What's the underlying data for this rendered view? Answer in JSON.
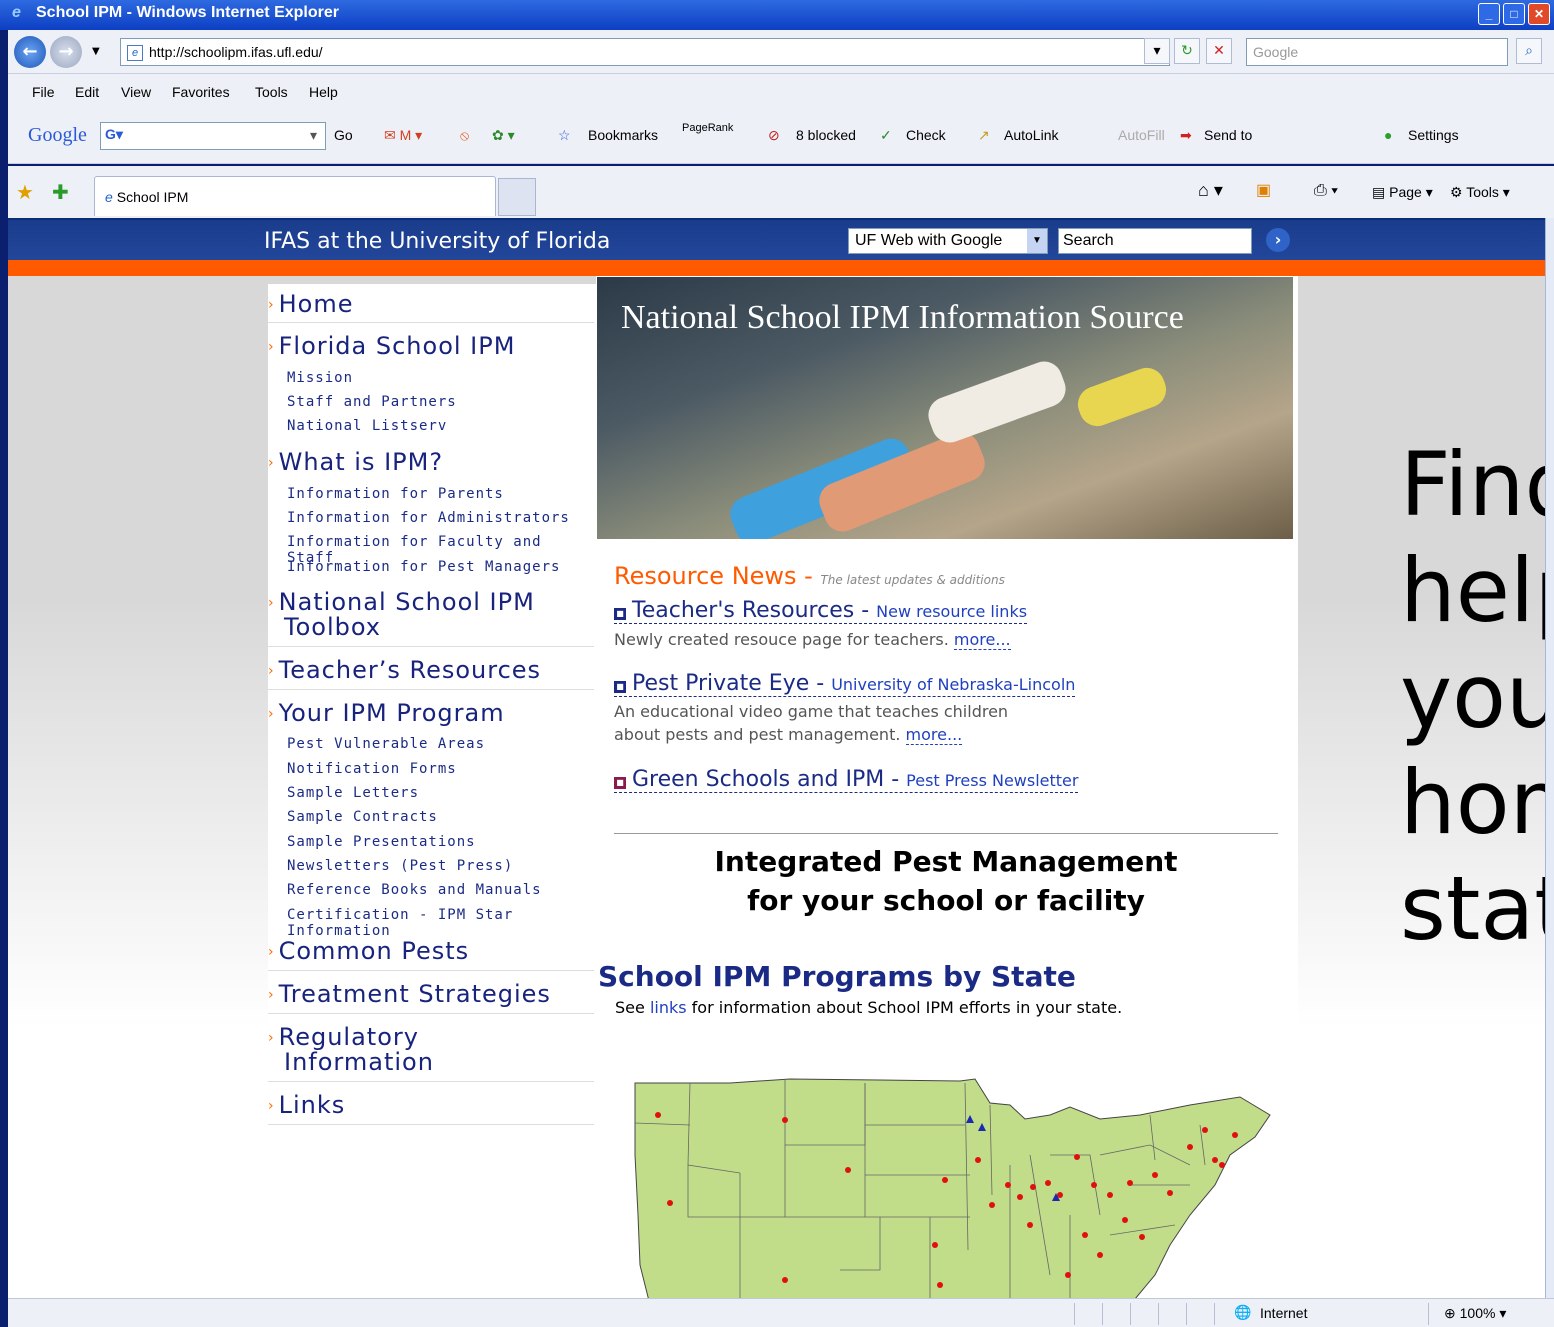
{
  "window": {
    "title": "School IPM - Windows Internet Explorer"
  },
  "address": {
    "url": "http://schoolipm.ifas.ufl.edu/",
    "search_placeholder": "Google"
  },
  "menu": [
    "File",
    "Edit",
    "View",
    "Favorites",
    "Tools",
    "Help"
  ],
  "toolbar": {
    "google_logo": "Google",
    "go": "Go",
    "bookmarks": "Bookmarks",
    "pagerank": "PageRank",
    "blocked": "8 blocked",
    "check": "Check",
    "autolink": "AutoLink",
    "autofill": "AutoFill",
    "sendto": "Send to",
    "settings": "Settings"
  },
  "tabs": {
    "active": "School IPM",
    "page_btn": "Page",
    "tools_btn": "Tools"
  },
  "ufheader": {
    "title": "IFAS at the University of Florida",
    "select": "UF Web with Google",
    "search": "Search"
  },
  "nav": {
    "home": "Home",
    "florida": "Florida School IPM",
    "florida_sub": [
      "Mission",
      "Staff and Partners",
      "National Listserv"
    ],
    "what": "What is IPM?",
    "what_sub": [
      "Information for Parents",
      "Information for Administrators",
      "Information for Faculty and Staff",
      "Information for Pest Managers"
    ],
    "toolbox_1": "National School IPM",
    "toolbox_2": "Toolbox",
    "teachers": "Teacher’s Resources",
    "program": "Your IPM Program",
    "program_sub": [
      "Pest Vulnerable Areas",
      "Notification Forms",
      "Sample Letters",
      "Sample Contracts",
      "Sample Presentations",
      "Newsletters (Pest Press)",
      "Reference Books and Manuals",
      "Certification - IPM Star Information"
    ],
    "pests": "Common Pests",
    "treatment": "Treatment Strategies",
    "regulatory_1": "Regulatory",
    "regulatory_2": "Information",
    "links": "Links"
  },
  "hero": {
    "title": "National School IPM Information Source"
  },
  "news": {
    "title": "Resource News",
    "dash": " - ",
    "subtitle": "The latest updates & additions",
    "items": [
      {
        "title": "Teacher's Resources",
        "link": "New resource links",
        "desc1": "Newly created resouce page for teachers.",
        "desc2": "",
        "more": "more..."
      },
      {
        "title": "Pest Private Eye",
        "link": "University of Nebraska-Lincoln",
        "desc1": "An educational video game that teaches children",
        "desc2": "about pests and pest management.",
        "more": "more..."
      },
      {
        "title": "Green Schools and IPM",
        "link": "Pest Press Newsletter"
      }
    ]
  },
  "ipm": {
    "line1": "Integrated Pest Management",
    "line2": "for your school or facility"
  },
  "states": {
    "title": "School IPM Programs by State",
    "pre": "See ",
    "link": "links",
    "post": " for information about School IPM efforts in your state."
  },
  "side": {
    "text": "Find\nhelp\nyour\nhome\nstate"
  },
  "status": {
    "zone": "Internet",
    "zoom": "100%"
  }
}
